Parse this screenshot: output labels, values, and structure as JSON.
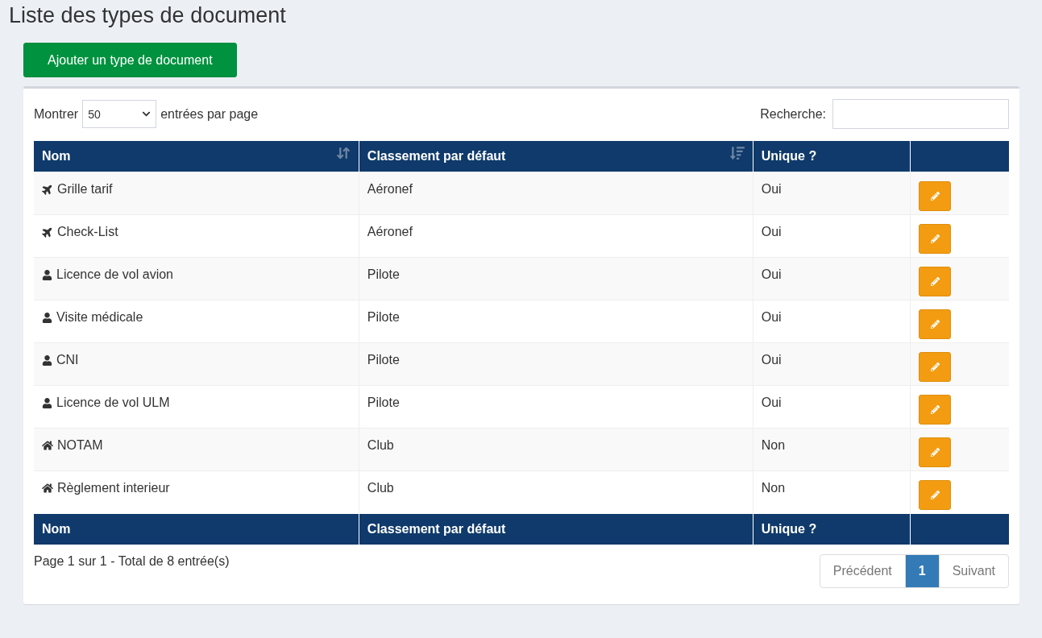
{
  "title": "Liste des types de document",
  "add_button": "Ajouter un type de document",
  "length": {
    "label_before": "Montrer",
    "value": "50",
    "label_after": "entrées par page"
  },
  "search": {
    "label": "Recherche:"
  },
  "table": {
    "columns": [
      {
        "label": "Nom",
        "kind": "sortable"
      },
      {
        "label": "Classement par défaut",
        "kind": "sorted"
      },
      {
        "label": "Unique ?",
        "kind": "plain"
      },
      {
        "kind": "actions"
      }
    ],
    "rows": [
      {
        "kind": "aircraft",
        "name": "Grille tarif",
        "category": "Aéronef",
        "unique": "Oui"
      },
      {
        "kind": "aircraft",
        "name": "Check-List",
        "category": "Aéronef",
        "unique": "Oui"
      },
      {
        "kind": "pilot",
        "name": "Licence de vol avion",
        "category": "Pilote",
        "unique": "Oui"
      },
      {
        "kind": "pilot",
        "name": "Visite médicale",
        "category": "Pilote",
        "unique": "Oui"
      },
      {
        "kind": "pilot",
        "name": "CNI",
        "category": "Pilote",
        "unique": "Oui"
      },
      {
        "kind": "pilot",
        "name": "Licence de vol ULM",
        "category": "Pilote",
        "unique": "Oui"
      },
      {
        "kind": "club",
        "name": "NOTAM",
        "category": "Club",
        "unique": "Non"
      },
      {
        "kind": "club",
        "name": "Règlement interieur",
        "category": "Club",
        "unique": "Non"
      }
    ],
    "footer": [
      "Nom",
      "Classement par défaut",
      "Unique ?"
    ]
  },
  "info": "Page 1 sur 1 - Total de 8 entrée(s)",
  "pagination": {
    "previous": {
      "label": "Précédent",
      "disabled": true
    },
    "pages": [
      {
        "label": "1",
        "selected": true
      }
    ],
    "next": {
      "label": "Suivant",
      "disabled": true
    }
  }
}
